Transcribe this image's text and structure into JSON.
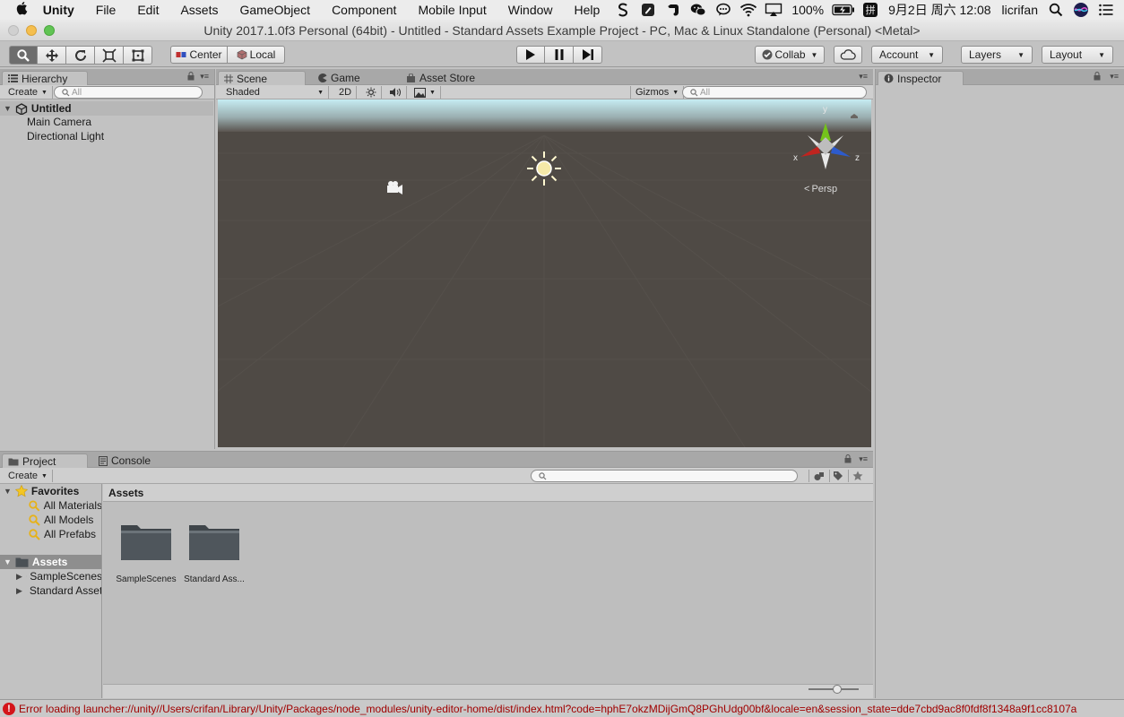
{
  "menubar": {
    "items": [
      "Unity",
      "File",
      "Edit",
      "Assets",
      "GameObject",
      "Component",
      "Mobile Input",
      "Window",
      "Help"
    ],
    "battery": "100%",
    "datetime": "9月2日 周六 12:08",
    "user": "licrifan",
    "ime": "拼"
  },
  "window": {
    "title": "Unity 2017.1.0f3 Personal (64bit) - Untitled - Standard Assets Example Project - PC, Mac & Linux Standalone (Personal) <Metal>"
  },
  "toolbar": {
    "pivot_label": "Center",
    "space_label": "Local",
    "collab_label": "Collab",
    "account_label": "Account",
    "layers_label": "Layers",
    "layout_label": "Layout"
  },
  "hierarchy": {
    "tab": "Hierarchy",
    "create_label": "Create",
    "search_placeholder": "All",
    "scene_name": "Untitled",
    "items": [
      "Main Camera",
      "Directional Light"
    ]
  },
  "scene": {
    "tabs": [
      "Scene",
      "Game",
      "Asset Store"
    ],
    "shading": "Shaded",
    "mode_2d": "2D",
    "gizmos_label": "Gizmos",
    "search_placeholder": "All",
    "projection": "Persp",
    "axes": [
      "x",
      "y",
      "z"
    ],
    "colors": {
      "sky": "#c6ecf2",
      "ground": "#4f4a45",
      "axis_x": "#c0241f",
      "axis_y": "#74c21b",
      "axis_z": "#2d5bcc"
    }
  },
  "inspector": {
    "tab": "Inspector"
  },
  "project": {
    "tabs": [
      "Project",
      "Console"
    ],
    "create_label": "Create",
    "favorites_label": "Favorites",
    "favorites": [
      "All Materials",
      "All Models",
      "All Prefabs"
    ],
    "assets_label": "Assets",
    "asset_tree": [
      "SampleScenes",
      "Standard Assets"
    ],
    "breadcrumb": "Assets",
    "folders": [
      "SampleScenes",
      "Standard Ass..."
    ]
  },
  "status": {
    "message": "Error loading launcher://unity//Users/crifan/Library/Unity/Packages/node_modules/unity-editor-home/dist/index.html?code=hphE7okzMDijGmQ8PGhUdg00bf&locale=en&session_state=dde7cbd9ac8f0fdf8f1348a9f1cc8107a",
    "color": "#a00000"
  }
}
